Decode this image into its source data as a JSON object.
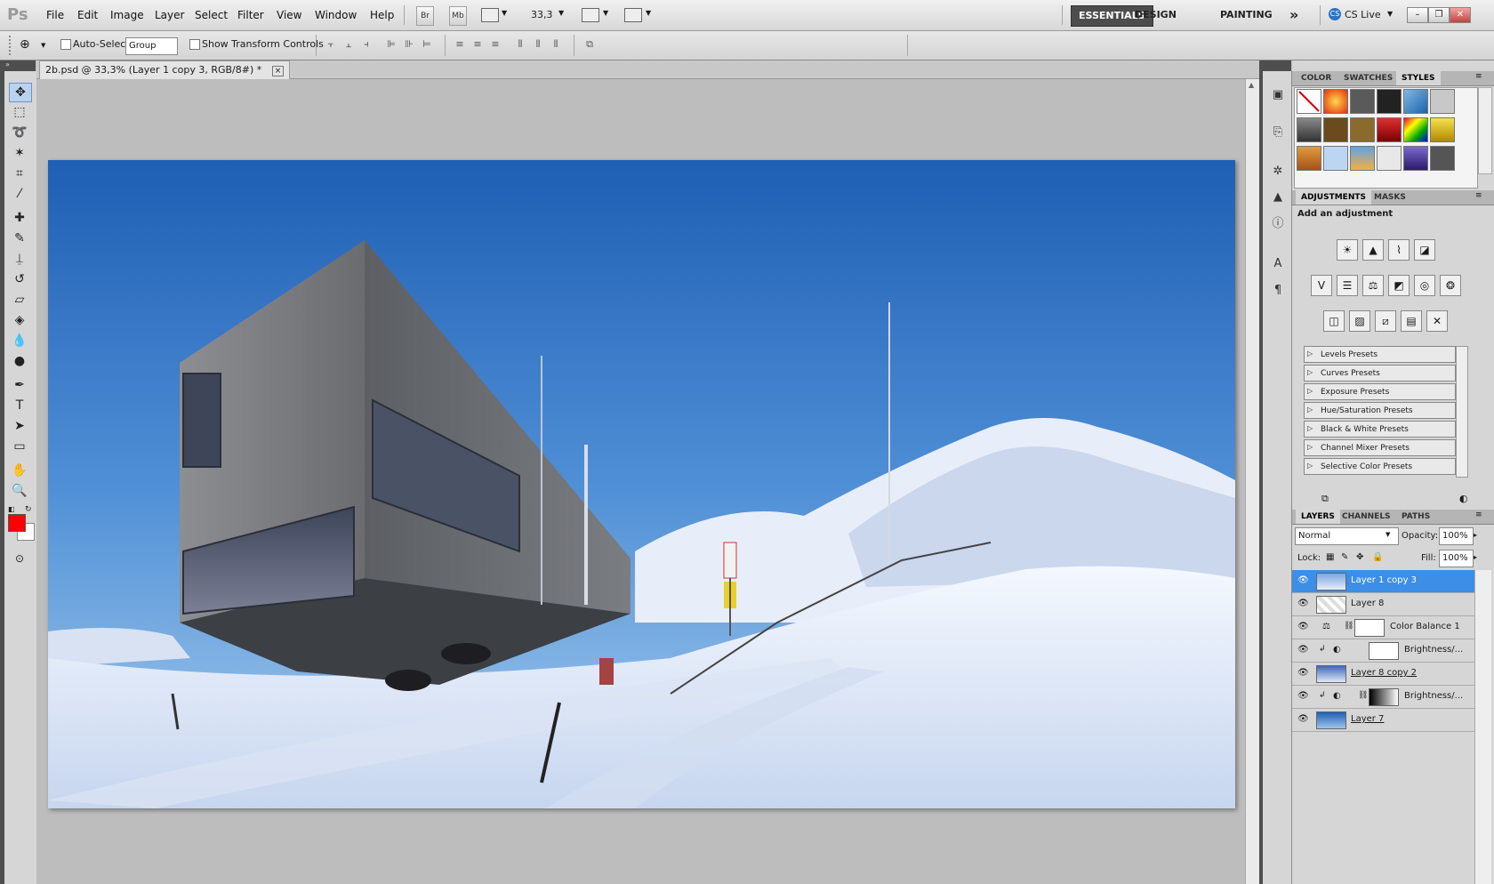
{
  "app": {
    "logo": "Ps"
  },
  "menu": [
    "File",
    "Edit",
    "Image",
    "Layer",
    "Select",
    "Filter",
    "View",
    "Window",
    "Help"
  ],
  "appbar": {
    "bridge": "Br",
    "minibridge": "Mb",
    "zoom": "33,3"
  },
  "workspaces": [
    "ESSENTIALS",
    "DESIGN",
    "PAINTING"
  ],
  "workspace_more": "»",
  "cslive": "CS Live",
  "options": {
    "auto_select_label": "Auto-Select:",
    "auto_select_value": "Group",
    "show_transform_label": "Show Transform Controls"
  },
  "document": {
    "tab_title": "2b.psd @ 33,3% (Layer 1 copy 3, RGB/8#) *",
    "close": "×"
  },
  "panels": {
    "top_tabs": [
      "COLOR",
      "SWATCHES",
      "STYLES"
    ],
    "adj_tabs": [
      "ADJUSTMENTS",
      "MASKS"
    ],
    "adj_heading": "Add an adjustment",
    "presets": [
      "Levels Presets",
      "Curves Presets",
      "Exposure Presets",
      "Hue/Saturation Presets",
      "Black & White Presets",
      "Channel Mixer Presets",
      "Selective Color Presets"
    ],
    "layer_tabs": [
      "LAYERS",
      "CHANNELS",
      "PATHS"
    ],
    "blend_mode": "Normal",
    "opacity_label": "Opacity:",
    "opacity_value": "100%",
    "lock_label": "Lock:",
    "fill_label": "Fill:",
    "fill_value": "100%"
  },
  "layers": [
    {
      "name": "Layer 1 copy 3",
      "selected": true
    },
    {
      "name": "Layer 8",
      "selected": false
    },
    {
      "name": "Color Balance 1",
      "selected": false
    },
    {
      "name": "Brightness/...",
      "selected": false
    },
    {
      "name": "Layer 8 copy 2",
      "selected": false
    },
    {
      "name": "Brightness/...",
      "selected": false
    },
    {
      "name": "Layer 7",
      "selected": false
    }
  ],
  "colors": {
    "foreground": "#ff0000",
    "background": "#ffffff",
    "selection": "#3d8ee6"
  }
}
